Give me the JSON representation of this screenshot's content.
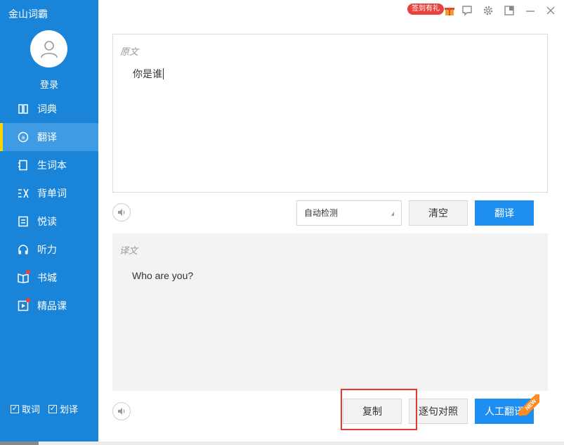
{
  "app": {
    "title": "金山词霸"
  },
  "sidebar": {
    "login_label": "登录",
    "items": [
      {
        "label": "词典",
        "icon": "book-open-icon",
        "active": false,
        "dot": false
      },
      {
        "label": "翻译",
        "icon": "translate-icon",
        "active": true,
        "dot": false
      },
      {
        "label": "生词本",
        "icon": "notebook-icon",
        "active": false,
        "dot": false
      },
      {
        "label": "背单词",
        "icon": "memorize-icon",
        "active": false,
        "dot": false
      },
      {
        "label": "悦读",
        "icon": "reading-icon",
        "active": false,
        "dot": false
      },
      {
        "label": "听力",
        "icon": "headphones-icon",
        "active": false,
        "dot": false
      },
      {
        "label": "书城",
        "icon": "bookstore-icon",
        "active": false,
        "dot": true
      },
      {
        "label": "精品课",
        "icon": "video-course-icon",
        "active": false,
        "dot": true
      }
    ],
    "bottom": {
      "quick_lookup": {
        "label": "取词",
        "checked": true
      },
      "selection_translate": {
        "label": "划译",
        "checked": true
      }
    }
  },
  "topbar": {
    "gift_badge": "签到有礼"
  },
  "source": {
    "label": "原文",
    "text": "你是谁"
  },
  "controls": {
    "language_select": "自动检测",
    "clear_button": "清空",
    "translate_button": "翻译"
  },
  "target": {
    "label": "译文",
    "text": "Who are you?"
  },
  "bottom_actions": {
    "copy_button": "复制",
    "sentence_compare_button": "逐句对照",
    "human_translate_button": "人工翻译",
    "new_badge": "NEW"
  },
  "colors": {
    "sidebar": "#1a84d8",
    "active_item": "#3f9be4",
    "active_marker": "#ffd400",
    "primary_button": "#1e8ef0",
    "highlight_box": "#e53935"
  }
}
